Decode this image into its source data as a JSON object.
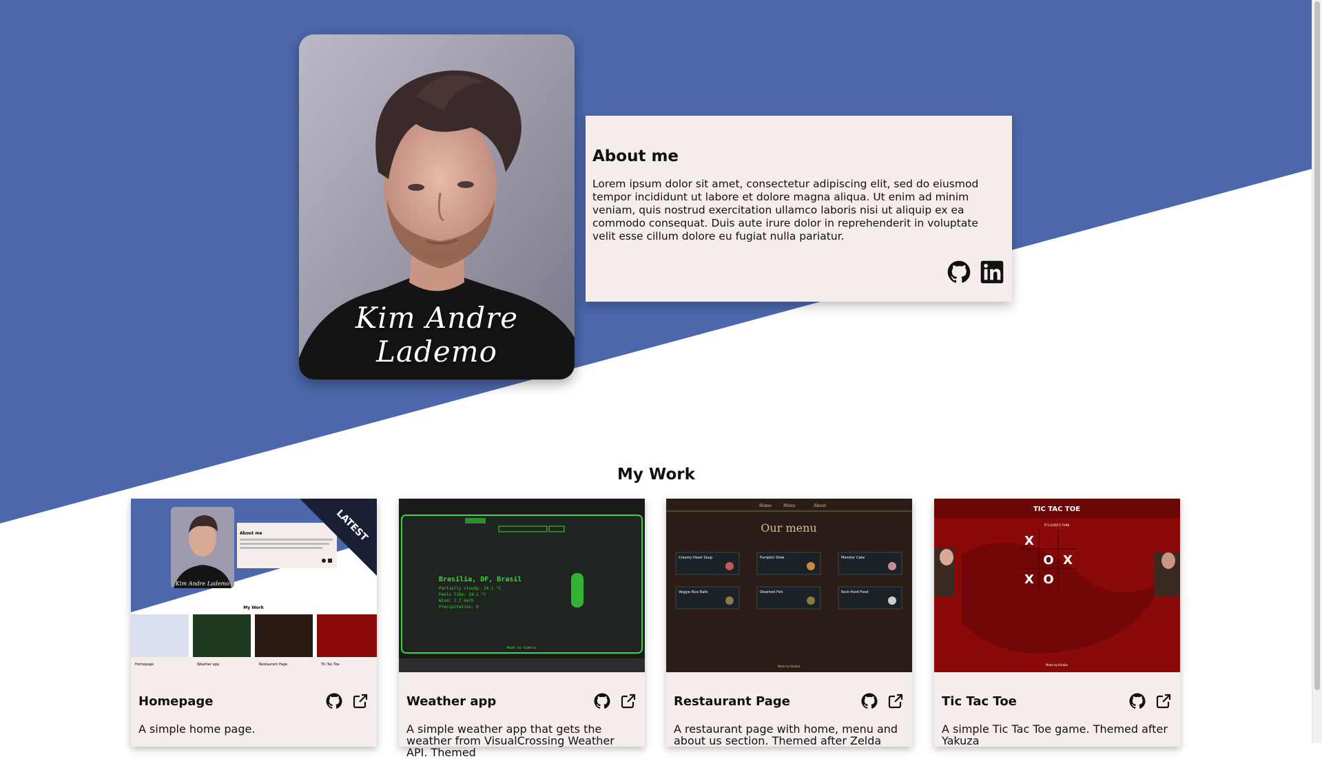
{
  "hero": {
    "name_signature": "Kim Andre Lademo"
  },
  "about": {
    "heading": "About me",
    "text": "Lorem ipsum dolor sit amet, consectetur adipiscing elit, sed do eiusmod tempor incididunt ut labore et dolore magna aliqua. Ut enim ad minim veniam, quis nostrud exercitation ullamco laboris nisi ut aliquip ex ea commodo consequat. Duis aute irure dolor in reprehenderit in voluptate velit esse cillum dolore eu fugiat nulla pariatur.",
    "icons": [
      "github-icon",
      "linkedin-icon"
    ]
  },
  "work": {
    "heading": "My Work",
    "projects": [
      {
        "name": "Homepage",
        "description": "A simple home page.",
        "badge": "LATEST",
        "thumb_title": "My Work",
        "thumb_about": "About me",
        "thumb_signature": "Kim Andre Lademo",
        "thumb_projects": [
          "Homepage",
          "Weather app",
          "Restaurant Page",
          "Tic Tac Toe"
        ]
      },
      {
        "name": "Weather app",
        "description": "A simple weather app that gets the weather from VisualCrossing Weather API. Themed",
        "thumb_lines": [
          "Brasilia, DF, Brasil",
          "Partially cloudy, 24.1 °C",
          "Feels like: 24.1 °C",
          "Wind: 7.7 km/h",
          "Precipitation: 0"
        ],
        "thumb_footer": "Made by Kimble"
      },
      {
        "name": "Restaurant Page",
        "description": "A restaurant page with home, menu and about us section. Themed after Zelda",
        "thumb_nav": [
          "Home",
          "Menu",
          "About"
        ],
        "thumb_title": "Our menu",
        "thumb_items": [
          "Creamy Heart Soup",
          "Pumpkin Stew",
          "Monster Cake",
          "Veggie Rice Balls",
          "Steamed Fish",
          "Rock-Hard Food"
        ],
        "thumb_footer": "Made by Kimble"
      },
      {
        "name": "Tic Tac Toe",
        "description": "A simple Tic Tac Toe game. Themed after Yakuza",
        "thumb_title": "TIC TAC TOE",
        "thumb_subtitle": "IT'S GORO'S TURN",
        "thumb_board": [
          "X",
          "",
          "",
          "",
          "O",
          "X",
          "X",
          "O",
          ""
        ],
        "thumb_footer": "Made by Kimble"
      }
    ]
  },
  "colors": {
    "hero_bg": "#4c67ab",
    "card_bg": "#f5ecec",
    "yakuza_red": "#8a0a0a",
    "weather_green": "#3ad63a"
  }
}
